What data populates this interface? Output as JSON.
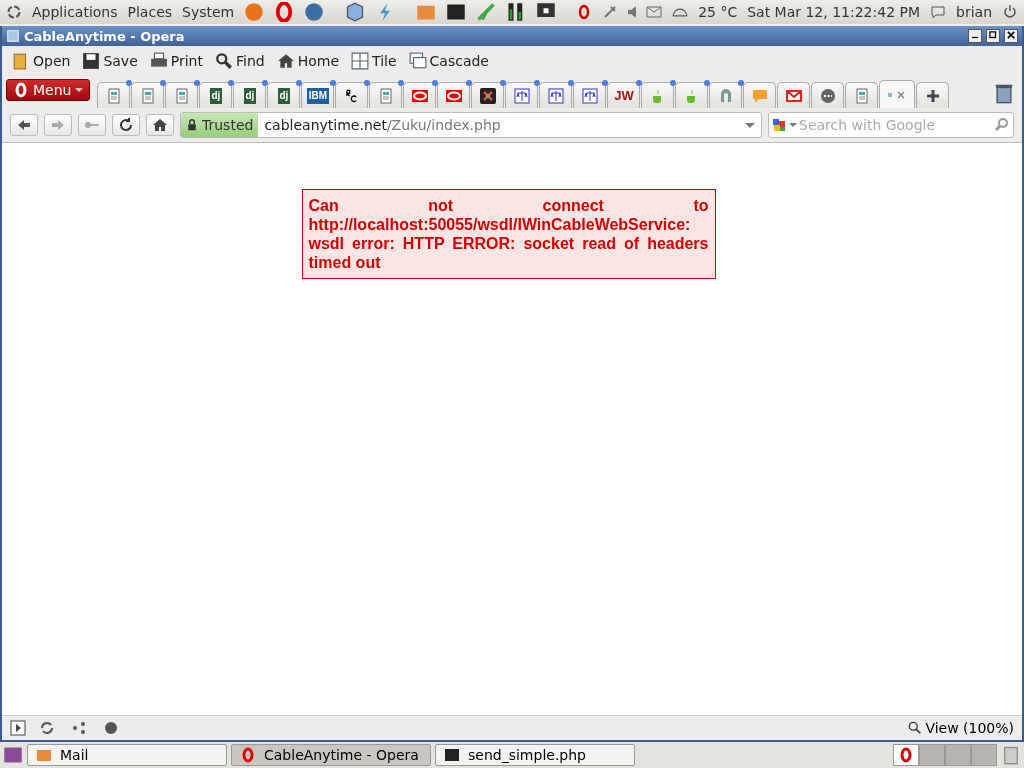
{
  "top_panel": {
    "menus": [
      "Applications",
      "Places",
      "System"
    ],
    "weather": "25 °C",
    "clock": "Sat Mar 12, 11:22:42 PM",
    "user": "brian"
  },
  "window": {
    "title": "CableAnytime - Opera"
  },
  "toolbar": [
    "Open",
    "Save",
    "Print",
    "Find",
    "Home",
    "Tile",
    "Cascade"
  ],
  "menu_button": "Menu",
  "tabs": [
    {
      "kind": "page",
      "unread": true,
      "selected": false
    },
    {
      "kind": "page",
      "unread": true,
      "selected": false
    },
    {
      "kind": "page",
      "unread": true,
      "selected": false
    },
    {
      "kind": "letters",
      "text": "dj",
      "color": "#2d5e3a",
      "unread": true,
      "selected": false
    },
    {
      "kind": "letters",
      "text": "dj",
      "color": "#2d5e3a",
      "unread": true,
      "selected": false
    },
    {
      "kind": "letters",
      "text": "dj",
      "color": "#2d5e3a",
      "unread": true,
      "selected": false
    },
    {
      "kind": "letters",
      "text": "IBM",
      "color": "#1f5f9e",
      "unread": true,
      "selected": false
    },
    {
      "kind": "rc",
      "unread": true,
      "selected": false
    },
    {
      "kind": "page",
      "unread": true,
      "selected": false
    },
    {
      "kind": "oval",
      "unread": true,
      "selected": false
    },
    {
      "kind": "oval",
      "unread": true,
      "selected": false
    },
    {
      "kind": "joomla",
      "unread": true,
      "selected": false
    },
    {
      "kind": "scale",
      "unread": true,
      "selected": false
    },
    {
      "kind": "scale",
      "unread": true,
      "selected": false
    },
    {
      "kind": "scale",
      "unread": true,
      "selected": false
    },
    {
      "kind": "jw",
      "text": "JW",
      "unread": true,
      "selected": false
    },
    {
      "kind": "cup",
      "unread": true,
      "selected": false
    },
    {
      "kind": "cup",
      "unread": true,
      "selected": false
    },
    {
      "kind": "arch",
      "unread": true,
      "selected": false
    },
    {
      "kind": "bubble",
      "unread": false,
      "selected": false
    },
    {
      "kind": "mail",
      "unread": false,
      "selected": false
    },
    {
      "kind": "dots",
      "unread": false,
      "selected": false
    },
    {
      "kind": "page",
      "unread": false,
      "selected": false
    },
    {
      "kind": "blank",
      "unread": false,
      "selected": true
    }
  ],
  "address": {
    "security": "Trusted",
    "host": "cableanytime.net",
    "path": "/Zuku/index.php"
  },
  "search": {
    "placeholder": "Search with Google"
  },
  "error_message": "Can not connect to http://localhost:50055/wsdl/IWinCableWebService: wsdl error: HTTP ERROR: socket read of headers timed out",
  "status_bar": {
    "zoom": "View (100%)"
  },
  "taskbar": [
    {
      "kind": "folder",
      "label": "Mail",
      "selected": false
    },
    {
      "kind": "opera",
      "label": "CableAnytime - Opera",
      "selected": true
    },
    {
      "kind": "terminal",
      "label": "send_simple.php",
      "selected": false
    }
  ]
}
